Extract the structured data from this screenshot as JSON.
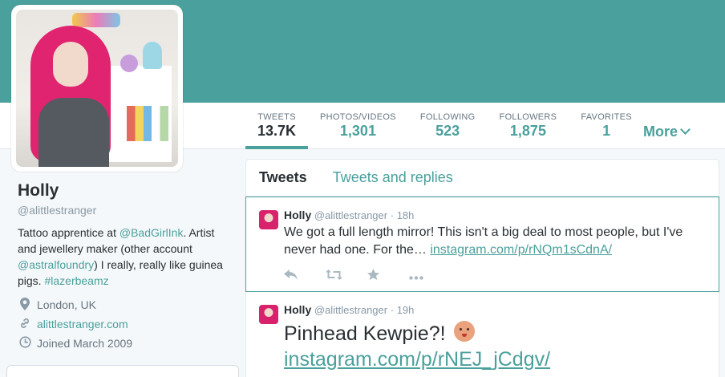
{
  "profile": {
    "name": "Holly",
    "handle": "@alittlestranger",
    "bio": {
      "part1": "Tattoo apprentice at ",
      "link1": "@BadGirlInk",
      "part2": ". Artist and jewellery maker (other account ",
      "link2": "@astralfoundry",
      "part3": ") I really, really like guinea pigs. ",
      "hashtag": "#lazerbeamz"
    },
    "location": "London, UK",
    "website": "alittlestranger.com",
    "joined": "Joined March 2009"
  },
  "stats": [
    {
      "label": "TWEETS",
      "value": "13.7K"
    },
    {
      "label": "PHOTOS/VIDEOS",
      "value": "1,301"
    },
    {
      "label": "FOLLOWING",
      "value": "523"
    },
    {
      "label": "FOLLOWERS",
      "value": "1,875"
    },
    {
      "label": "FAVORITES",
      "value": "1"
    }
  ],
  "more_label": "More",
  "tabs": [
    "Tweets",
    "Tweets and replies"
  ],
  "tweets": [
    {
      "name": "Holly",
      "handle": "@alittlestranger",
      "time": "18h",
      "text": "We got a full length mirror! This isn't a big deal to most people, but I've never had one. For the… ",
      "link": "instagram.com/p/rNQm1sCdnA/"
    },
    {
      "name": "Holly",
      "handle": "@alittlestranger",
      "time": "19h",
      "text": "Pinhead Kewpie?! ",
      "link": "instagram.com/p/rNEJ_jCdgv/"
    }
  ],
  "icons": {
    "reply": "reply-icon",
    "retweet": "retweet-icon",
    "favorite": "star-icon",
    "more": "ellipsis-icon",
    "location": "map-pin-icon",
    "website": "link-icon",
    "joined": "clock-icon"
  },
  "colors": {
    "header": "#4aa09c",
    "link": "#4aa09c",
    "text": "#292f33",
    "muted": "#8899a6"
  }
}
